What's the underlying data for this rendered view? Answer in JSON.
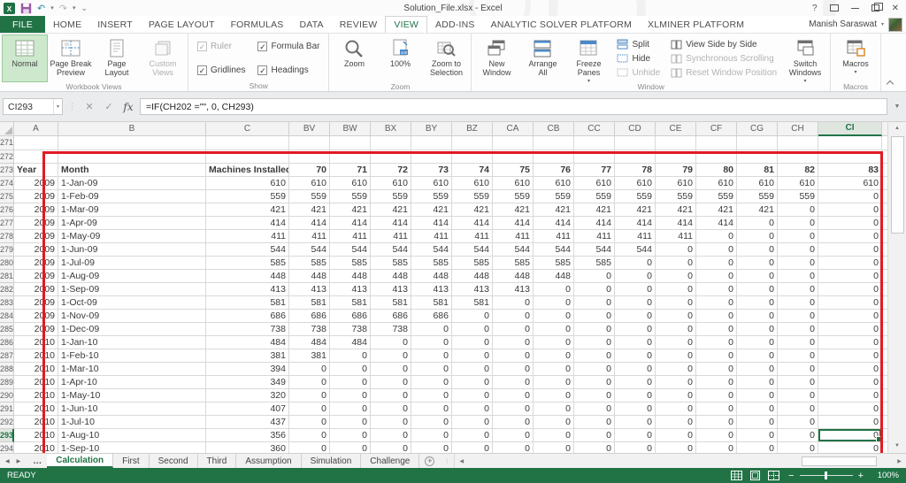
{
  "title_bar": {
    "title": "Solution_File.xlsx - Excel",
    "qat_icons": [
      "excel-logo",
      "save",
      "undo",
      "redo",
      "customize-quick-access"
    ],
    "help": "?",
    "close": "✕",
    "user_name": "Manish Saraswat"
  },
  "ribbon_tabs": [
    {
      "label": "FILE",
      "file": true
    },
    {
      "label": "HOME"
    },
    {
      "label": "INSERT"
    },
    {
      "label": "PAGE LAYOUT"
    },
    {
      "label": "FORMULAS"
    },
    {
      "label": "DATA"
    },
    {
      "label": "REVIEW"
    },
    {
      "label": "VIEW",
      "active": true
    },
    {
      "label": "ADD-INS"
    },
    {
      "label": "ANALYTIC SOLVER PLATFORM"
    },
    {
      "label": "XLMINER PLATFORM"
    }
  ],
  "ribbon": {
    "groups": [
      {
        "label": "Workbook Views",
        "items": [
          {
            "type": "big",
            "label": "Normal",
            "icon": "normal-view",
            "active": true
          },
          {
            "type": "big",
            "label": "Page Break\nPreview",
            "icon": "page-break-preview"
          },
          {
            "type": "big",
            "label": "Page\nLayout",
            "icon": "page-layout"
          },
          {
            "type": "big",
            "label": "Custom\nViews",
            "icon": "custom-views",
            "disabled": true
          }
        ]
      },
      {
        "label": "Show",
        "items": [
          {
            "type": "check",
            "label": "Ruler",
            "checked": true,
            "disabled": true
          },
          {
            "type": "check",
            "label": "Formula Bar",
            "checked": true
          },
          {
            "type": "check",
            "label": "Gridlines",
            "checked": true
          },
          {
            "type": "check",
            "label": "Headings",
            "checked": true
          }
        ]
      },
      {
        "label": "Zoom",
        "items": [
          {
            "type": "big",
            "label": "Zoom",
            "icon": "zoom-magnifier"
          },
          {
            "type": "big",
            "label": "100%",
            "icon": "zoom-100"
          },
          {
            "type": "big",
            "label": "Zoom to\nSelection",
            "icon": "zoom-to-selection"
          }
        ]
      },
      {
        "label": "Window",
        "items": [
          {
            "type": "big",
            "label": "New\nWindow",
            "icon": "new-window"
          },
          {
            "type": "big",
            "label": "Arrange\nAll",
            "icon": "arrange-all"
          },
          {
            "type": "big",
            "label": "Freeze\nPanes",
            "icon": "freeze-panes",
            "dropdown": true
          },
          {
            "type": "stack",
            "items": [
              {
                "label": "Split",
                "icon": "split"
              },
              {
                "label": "Hide",
                "icon": "hide"
              },
              {
                "label": "Unhide",
                "icon": "unhide",
                "disabled": true
              }
            ]
          },
          {
            "type": "stack",
            "items": [
              {
                "label": "View Side by Side",
                "icon": "view-side-by-side"
              },
              {
                "label": "Synchronous Scrolling",
                "icon": "synchronous-scrolling",
                "disabled": true
              },
              {
                "label": "Reset Window Position",
                "icon": "reset-window-position",
                "disabled": true
              }
            ]
          },
          {
            "type": "big",
            "label": "Switch\nWindows",
            "icon": "switch-windows",
            "dropdown": true
          }
        ]
      },
      {
        "label": "Macros",
        "items": [
          {
            "type": "big",
            "label": "Macros",
            "icon": "macros",
            "dropdown": true
          }
        ]
      }
    ]
  },
  "formula_bar": {
    "name_box": "CI293",
    "cancel": "✕",
    "enter": "✓",
    "fx": "fx",
    "formula": "=IF(CH202 =\"\", 0, CH293)"
  },
  "grid": {
    "selected_cell": "CI293",
    "selected_column": "CI",
    "selected_row": "293",
    "columns": [
      "A",
      "B",
      "C",
      "BV",
      "BW",
      "BX",
      "BY",
      "BZ",
      "CA",
      "CB",
      "CC",
      "CD",
      "CE",
      "CF",
      "CG",
      "CH",
      "CI"
    ],
    "rows": [
      {
        "n": "271",
        "a": "",
        "b": "",
        "c": "",
        "v": [
          "",
          "",
          "",
          "",
          "",
          "",
          "",
          "",
          "",
          "",
          "",
          "",
          "",
          ""
        ]
      },
      {
        "n": "272",
        "a": "",
        "b": "",
        "c": "",
        "v": [
          "",
          "",
          "",
          "",
          "",
          "",
          "",
          "",
          "",
          "",
          "",
          "",
          "",
          ""
        ]
      },
      {
        "n": "273",
        "a": "Year",
        "b": "Month",
        "c": "Machines Installed",
        "v": [
          "70",
          "71",
          "72",
          "73",
          "74",
          "75",
          "76",
          "77",
          "78",
          "79",
          "80",
          "81",
          "82",
          "83"
        ],
        "header": true
      },
      {
        "n": "274",
        "a": "2009",
        "b": "1-Jan-09",
        "c": "610",
        "v": [
          "610",
          "610",
          "610",
          "610",
          "610",
          "610",
          "610",
          "610",
          "610",
          "610",
          "610",
          "610",
          "610",
          "610"
        ]
      },
      {
        "n": "275",
        "a": "2009",
        "b": "1-Feb-09",
        "c": "559",
        "v": [
          "559",
          "559",
          "559",
          "559",
          "559",
          "559",
          "559",
          "559",
          "559",
          "559",
          "559",
          "559",
          "559",
          "0"
        ]
      },
      {
        "n": "276",
        "a": "2009",
        "b": "1-Mar-09",
        "c": "421",
        "v": [
          "421",
          "421",
          "421",
          "421",
          "421",
          "421",
          "421",
          "421",
          "421",
          "421",
          "421",
          "421",
          "0",
          "0"
        ]
      },
      {
        "n": "277",
        "a": "2009",
        "b": "1-Apr-09",
        "c": "414",
        "v": [
          "414",
          "414",
          "414",
          "414",
          "414",
          "414",
          "414",
          "414",
          "414",
          "414",
          "414",
          "0",
          "0",
          "0"
        ]
      },
      {
        "n": "278",
        "a": "2009",
        "b": "1-May-09",
        "c": "411",
        "v": [
          "411",
          "411",
          "411",
          "411",
          "411",
          "411",
          "411",
          "411",
          "411",
          "411",
          "0",
          "0",
          "0",
          "0"
        ]
      },
      {
        "n": "279",
        "a": "2009",
        "b": "1-Jun-09",
        "c": "544",
        "v": [
          "544",
          "544",
          "544",
          "544",
          "544",
          "544",
          "544",
          "544",
          "544",
          "0",
          "0",
          "0",
          "0",
          "0"
        ]
      },
      {
        "n": "280",
        "a": "2009",
        "b": "1-Jul-09",
        "c": "585",
        "v": [
          "585",
          "585",
          "585",
          "585",
          "585",
          "585",
          "585",
          "585",
          "0",
          "0",
          "0",
          "0",
          "0",
          "0"
        ]
      },
      {
        "n": "281",
        "a": "2009",
        "b": "1-Aug-09",
        "c": "448",
        "v": [
          "448",
          "448",
          "448",
          "448",
          "448",
          "448",
          "448",
          "0",
          "0",
          "0",
          "0",
          "0",
          "0",
          "0"
        ]
      },
      {
        "n": "282",
        "a": "2009",
        "b": "1-Sep-09",
        "c": "413",
        "v": [
          "413",
          "413",
          "413",
          "413",
          "413",
          "413",
          "0",
          "0",
          "0",
          "0",
          "0",
          "0",
          "0",
          "0"
        ]
      },
      {
        "n": "283",
        "a": "2009",
        "b": "1-Oct-09",
        "c": "581",
        "v": [
          "581",
          "581",
          "581",
          "581",
          "581",
          "0",
          "0",
          "0",
          "0",
          "0",
          "0",
          "0",
          "0",
          "0"
        ]
      },
      {
        "n": "284",
        "a": "2009",
        "b": "1-Nov-09",
        "c": "686",
        "v": [
          "686",
          "686",
          "686",
          "686",
          "0",
          "0",
          "0",
          "0",
          "0",
          "0",
          "0",
          "0",
          "0",
          "0"
        ]
      },
      {
        "n": "285",
        "a": "2009",
        "b": "1-Dec-09",
        "c": "738",
        "v": [
          "738",
          "738",
          "738",
          "0",
          "0",
          "0",
          "0",
          "0",
          "0",
          "0",
          "0",
          "0",
          "0",
          "0"
        ]
      },
      {
        "n": "286",
        "a": "2010",
        "b": "1-Jan-10",
        "c": "484",
        "v": [
          "484",
          "484",
          "0",
          "0",
          "0",
          "0",
          "0",
          "0",
          "0",
          "0",
          "0",
          "0",
          "0",
          "0"
        ]
      },
      {
        "n": "287",
        "a": "2010",
        "b": "1-Feb-10",
        "c": "381",
        "v": [
          "381",
          "0",
          "0",
          "0",
          "0",
          "0",
          "0",
          "0",
          "0",
          "0",
          "0",
          "0",
          "0",
          "0"
        ]
      },
      {
        "n": "288",
        "a": "2010",
        "b": "1-Mar-10",
        "c": "394",
        "v": [
          "0",
          "0",
          "0",
          "0",
          "0",
          "0",
          "0",
          "0",
          "0",
          "0",
          "0",
          "0",
          "0",
          "0"
        ]
      },
      {
        "n": "289",
        "a": "2010",
        "b": "1-Apr-10",
        "c": "349",
        "v": [
          "0",
          "0",
          "0",
          "0",
          "0",
          "0",
          "0",
          "0",
          "0",
          "0",
          "0",
          "0",
          "0",
          "0"
        ]
      },
      {
        "n": "290",
        "a": "2010",
        "b": "1-May-10",
        "c": "320",
        "v": [
          "0",
          "0",
          "0",
          "0",
          "0",
          "0",
          "0",
          "0",
          "0",
          "0",
          "0",
          "0",
          "0",
          "0"
        ]
      },
      {
        "n": "291",
        "a": "2010",
        "b": "1-Jun-10",
        "c": "407",
        "v": [
          "0",
          "0",
          "0",
          "0",
          "0",
          "0",
          "0",
          "0",
          "0",
          "0",
          "0",
          "0",
          "0",
          "0"
        ]
      },
      {
        "n": "292",
        "a": "2010",
        "b": "1-Jul-10",
        "c": "437",
        "v": [
          "0",
          "0",
          "0",
          "0",
          "0",
          "0",
          "0",
          "0",
          "0",
          "0",
          "0",
          "0",
          "0",
          "0"
        ]
      },
      {
        "n": "293",
        "a": "2010",
        "b": "1-Aug-10",
        "c": "356",
        "v": [
          "0",
          "0",
          "0",
          "0",
          "0",
          "0",
          "0",
          "0",
          "0",
          "0",
          "0",
          "0",
          "0",
          "0"
        ],
        "active": true
      },
      {
        "n": "294",
        "a": "2010",
        "b": "1-Sep-10",
        "c": "360",
        "v": [
          "0",
          "0",
          "0",
          "0",
          "0",
          "0",
          "0",
          "0",
          "0",
          "0",
          "0",
          "0",
          "0",
          "0"
        ]
      }
    ]
  },
  "sheet_tabs": {
    "overflow_indicator": "…",
    "tabs": [
      {
        "label": "Calculation",
        "active": true
      },
      {
        "label": "First"
      },
      {
        "label": "Second"
      },
      {
        "label": "Third"
      },
      {
        "label": "Assumption"
      },
      {
        "label": "Simulation"
      },
      {
        "label": "Challenge"
      }
    ],
    "add_button": "+"
  },
  "status_bar": {
    "mode": "READY",
    "view_icons": [
      "normal-view",
      "page-layout-view",
      "page-break-preview-view"
    ],
    "zoom_out": "−",
    "zoom_in": "+",
    "zoom_percent": "100%"
  }
}
